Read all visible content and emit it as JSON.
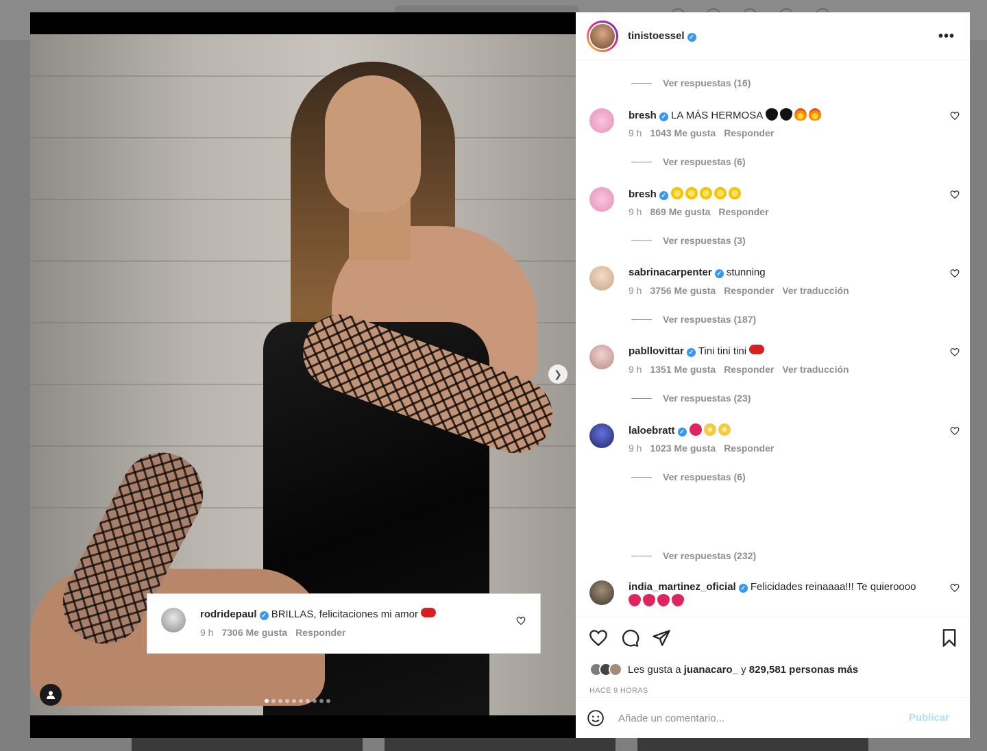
{
  "post": {
    "owner": "tinistoessel",
    "more_icon": "more-options-icon",
    "likes_text": "Les gusta a",
    "likes_user": "juanacaro_",
    "likes_and": "y",
    "likes_count": "829,581 personas más",
    "time_ago": "HACE 9 HORAS",
    "comment_placeholder": "Añade un comentario...",
    "publish_label": "Publicar"
  },
  "replies": [
    {
      "label": "Ver respuestas (16)"
    },
    {
      "label": "Ver respuestas (6)"
    },
    {
      "label": "Ver respuestas (3)"
    },
    {
      "label": "Ver respuestas (187)"
    },
    {
      "label": "Ver respuestas (23)"
    },
    {
      "label": "Ver respuestas (6)"
    },
    {
      "label": "Ver respuestas (232)"
    }
  ],
  "comments": [
    {
      "user": "bresh",
      "text": "LA MÁS HERMOSA",
      "time": "9 h",
      "likes": "1043 Me gusta",
      "reply": "Responder",
      "translate": ""
    },
    {
      "user": "bresh",
      "text": "",
      "time": "9 h",
      "likes": "869 Me gusta",
      "reply": "Responder",
      "translate": ""
    },
    {
      "user": "sabrinacarpenter",
      "text": "stunning",
      "time": "9 h",
      "likes": "3756 Me gusta",
      "reply": "Responder",
      "translate": "Ver traducción"
    },
    {
      "user": "pabllovittar",
      "text": "Tini tini tini",
      "time": "9 h",
      "likes": "1351 Me gusta",
      "reply": "Responder",
      "translate": "Ver traducción"
    },
    {
      "user": "laloebratt",
      "text": "",
      "time": "9 h",
      "likes": "1023 Me gusta",
      "reply": "Responder",
      "translate": ""
    },
    {
      "user": "india_martinez_oficial",
      "text": "Felicidades reinaaaa!!! Te quieroooo",
      "time": "",
      "likes": "",
      "reply": "",
      "translate": ""
    }
  ],
  "overlay_comment": {
    "user": "rodridepaul",
    "text": "BRILLAS, felicitaciones mi amor",
    "time": "9 h",
    "likes": "7306 Me gusta",
    "reply": "Responder"
  },
  "carousel": {
    "total_slides": 10,
    "active_slide": 1
  },
  "colors": {
    "verified": "#3897f0",
    "publish_disabled": "#b2dffc",
    "muted_text": "#8e8e8e"
  }
}
